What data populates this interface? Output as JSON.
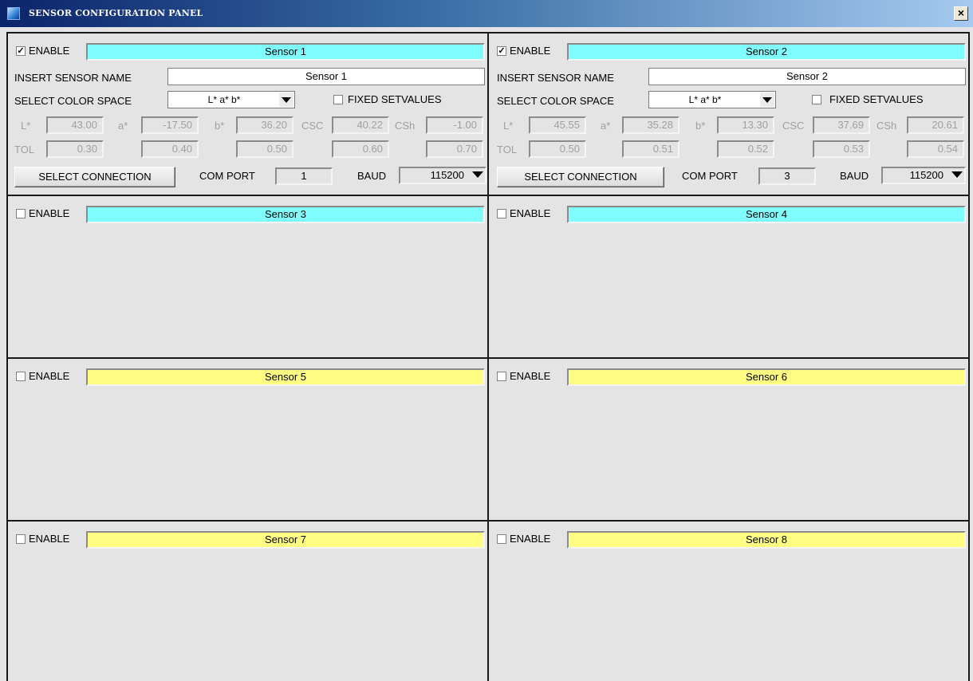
{
  "window": {
    "title": "SENSOR CONFIGURATION PANEL",
    "close_glyph": "×",
    "icon": "app-window-icon"
  },
  "colors": {
    "title_gradient_start": "#0b246a",
    "title_gradient_end": "#a6caf0",
    "namebar_cyan": "#7ffdff",
    "namebar_yellow": "#fffe82",
    "panel_bg": "#e4e4e4"
  },
  "labels": {
    "enable": "ENABLE",
    "insert_name": "INSERT SENSOR NAME",
    "select_color_space": "SELECT COLOR SPACE",
    "fixed_setvalues": "FIXED SETVALUES",
    "l": "L*",
    "a": "a*",
    "b": "b*",
    "csc": "CSC",
    "csh": "CSh",
    "tol": "TOL",
    "select_connection": "SELECT CONNECTION",
    "com_port": "COM PORT",
    "baud": "BAUD",
    "check_mark": "✓"
  },
  "sensors": [
    {
      "name": "Sensor 1",
      "enabled": true,
      "name_input": "Sensor 1",
      "color_space": "L* a* b*",
      "fixed_setvalues": false,
      "values": {
        "l": "43.00",
        "a": "-17.50",
        "b": "36.20",
        "csc": "40.22",
        "csh": "-1.00"
      },
      "tol": [
        "0.30",
        "0.40",
        "0.50",
        "0.60",
        "0.70"
      ],
      "com_port": "1",
      "baud": "115200"
    },
    {
      "name": "Sensor 2",
      "enabled": true,
      "name_input": "Sensor 2",
      "color_space": "L* a* b*",
      "fixed_setvalues": false,
      "values": {
        "l": "45.55",
        "a": "35.28",
        "b": "13.30",
        "csc": "37.69",
        "csh": "20.61"
      },
      "tol": [
        "0.50",
        "0.51",
        "0.52",
        "0.53",
        "0.54"
      ],
      "com_port": "3",
      "baud": "115200"
    },
    {
      "name": "Sensor 3",
      "enabled": false
    },
    {
      "name": "Sensor 4",
      "enabled": false
    },
    {
      "name": "Sensor 5",
      "enabled": false
    },
    {
      "name": "Sensor 6",
      "enabled": false
    },
    {
      "name": "Sensor 7",
      "enabled": false
    },
    {
      "name": "Sensor 8",
      "enabled": false
    }
  ]
}
